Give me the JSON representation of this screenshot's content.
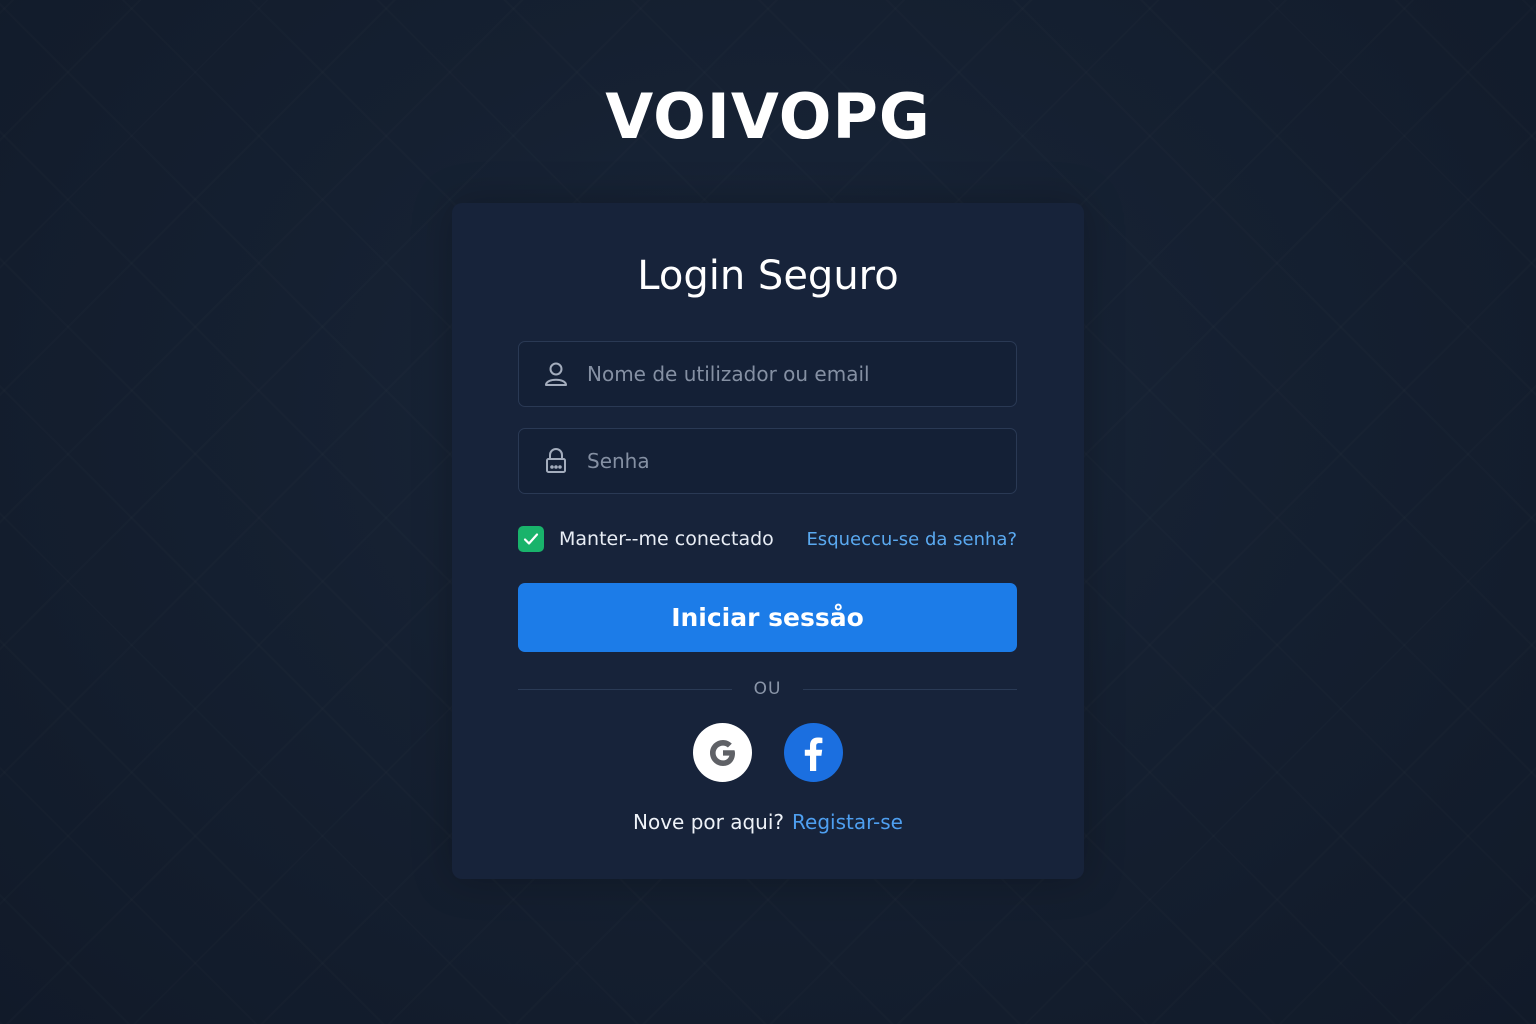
{
  "brand": {
    "name": "VOIVOPG"
  },
  "login": {
    "title": "Login Seguro",
    "username_placeholder": "Nome de utilizador ou email",
    "username_value": "",
    "password_placeholder": "Senha",
    "password_value": "",
    "remember_label": "Manter--me conectado",
    "remember_checked": true,
    "forgot_label": "Esqueccu-se da senha?",
    "submit_label": "Iniciar sessåo",
    "divider_text": "OU",
    "signup_prompt": "Nove por aqui?",
    "signup_link": "Registar-se"
  },
  "social": [
    {
      "provider": "google",
      "icon": "google-icon"
    },
    {
      "provider": "facebook",
      "icon": "facebook-icon"
    }
  ],
  "colors": {
    "background": "#152031",
    "card": "#17233a",
    "primary": "#1c7ce8",
    "link": "#5aa9f0",
    "checkbox": "#19b36b",
    "facebook": "#1b6fe0"
  }
}
